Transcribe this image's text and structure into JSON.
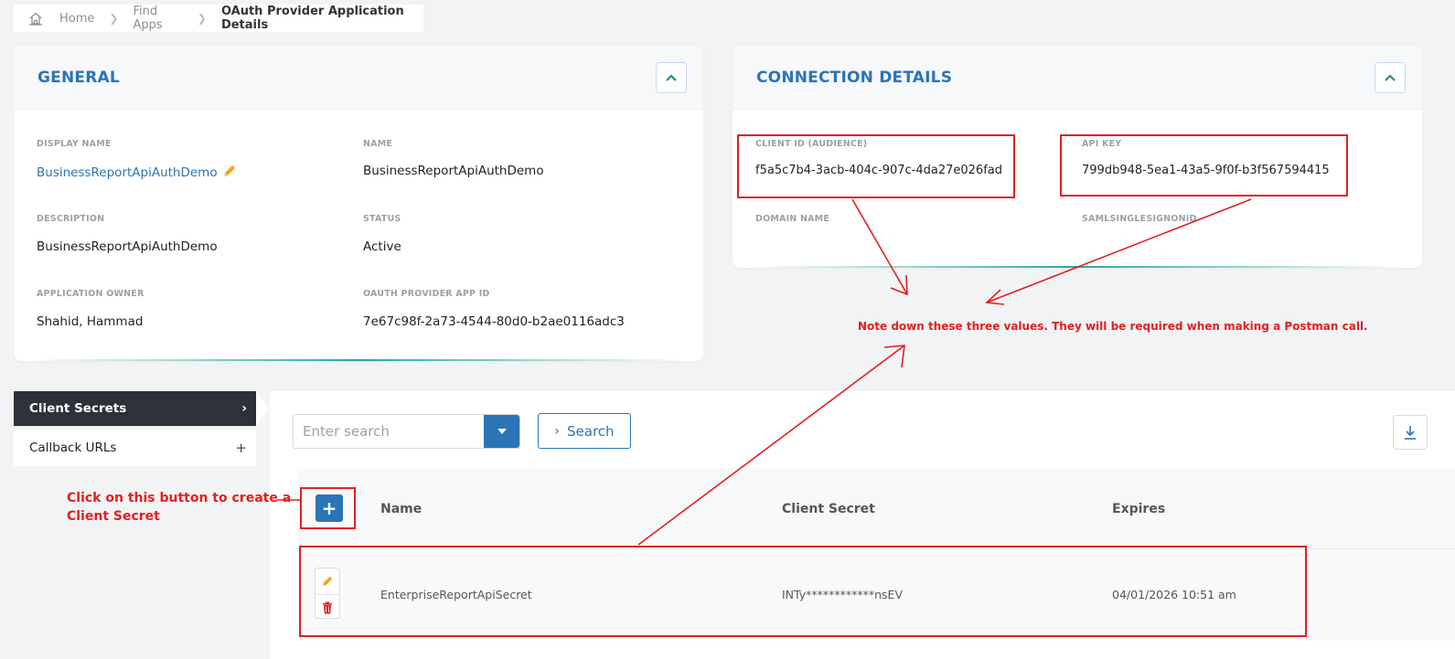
{
  "breadcrumb": {
    "home_icon": "home-icon",
    "items": [
      "Home",
      "Find Apps",
      "OAuth Provider Application Details"
    ]
  },
  "general": {
    "title": "GENERAL",
    "display_name_label": "DISPLAY NAME",
    "display_name": "BusinessReportApiAuthDemo",
    "name_label": "NAME",
    "name": "BusinessReportApiAuthDemo",
    "description_label": "DESCRIPTION",
    "description": "BusinessReportApiAuthDemo",
    "status_label": "STATUS",
    "status": "Active",
    "owner_label": "APPLICATION OWNER",
    "owner": "Shahid, Hammad",
    "app_id_label": "OAUTH PROVIDER APP ID",
    "app_id": "7e67c98f-2a73-4544-80d0-b2ae0116adc3"
  },
  "connection": {
    "title": "CONNECTION DETAILS",
    "client_id_label": "CLIENT ID (AUDIENCE)",
    "client_id": "f5a5c7b4-3acb-404c-907c-4da27e026fad",
    "api_key_label": "API KEY",
    "api_key": "799db948-5ea1-43a5-9f0f-b3f567594415",
    "domain_label": "DOMAIN NAME",
    "saml_label": "SAMLSINGLESIGNONID"
  },
  "tabs": {
    "client_secrets": "Client Secrets",
    "callback_urls": "Callback URLs"
  },
  "search": {
    "placeholder": "Enter search",
    "button": "Search"
  },
  "table": {
    "columns": [
      "Name",
      "Client Secret",
      "Expires"
    ],
    "rows": [
      {
        "name": "EnterpriseReportApiSecret",
        "secret": "INTy************nsEV",
        "expires": "04/01/2026 10:51 am"
      }
    ]
  },
  "annotations": {
    "note_values": "Note down these three values. They will be required when making a Postman call.",
    "note_button_line1": "Click on this button to create a",
    "note_button_line2": "Client Secret"
  },
  "colors": {
    "accent": "#2a74b8",
    "dark_tab": "#2d3139",
    "annotation": "#e02020",
    "teal": "#2aa79b"
  }
}
